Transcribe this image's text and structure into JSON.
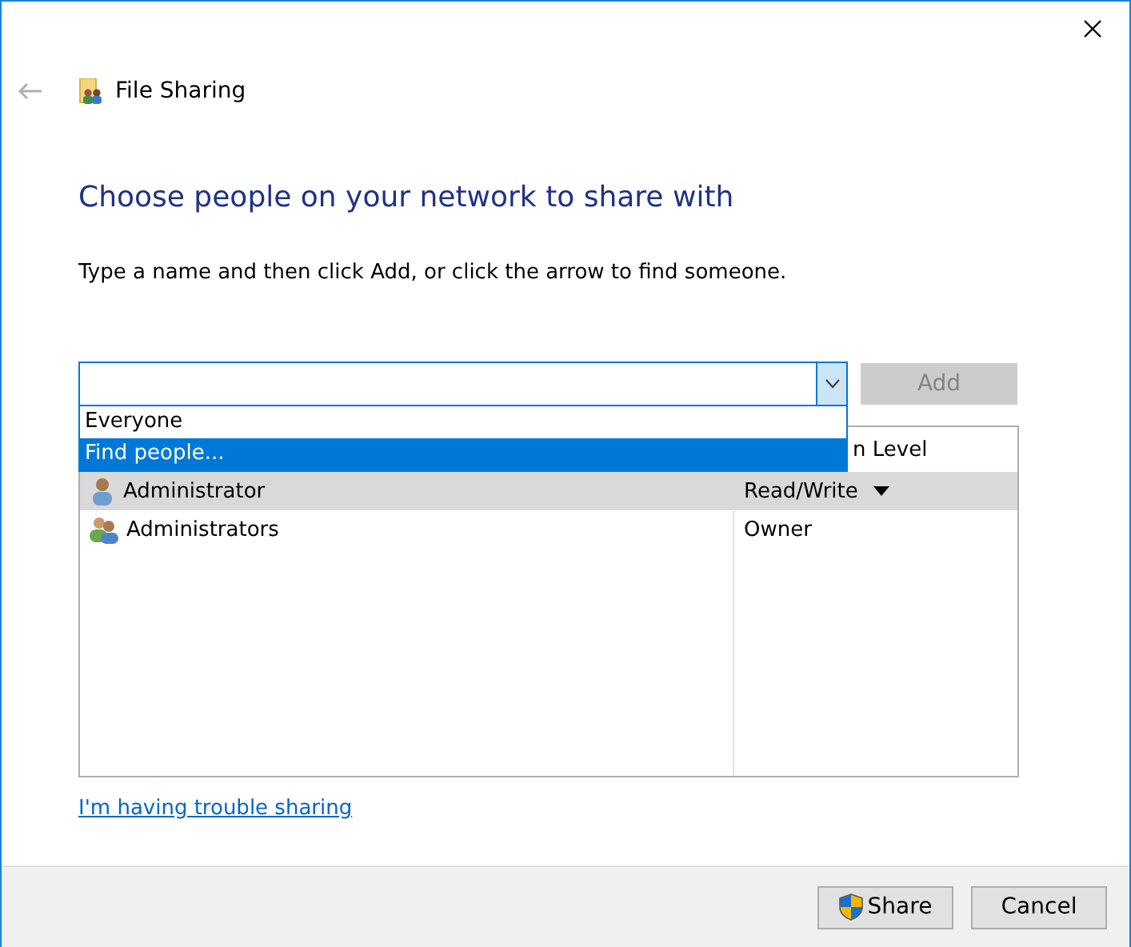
{
  "window": {
    "title": "File Sharing"
  },
  "heading": "Choose people on your network to share with",
  "instruction": "Type a name and then click Add, or click the arrow to find someone.",
  "combo": {
    "expanded": true,
    "options": [
      {
        "label": "Everyone",
        "selected": false
      },
      {
        "label": "Find people...",
        "selected": true
      }
    ]
  },
  "add_button": {
    "label": "Add",
    "disabled": true
  },
  "table": {
    "columns": [
      "",
      "n Level"
    ],
    "rows": [
      {
        "name": "Administrator",
        "kind": "user",
        "level": "Read/Write",
        "has_menu": true,
        "selected": true
      },
      {
        "name": "Administrators",
        "kind": "group",
        "level": "Owner",
        "has_menu": false,
        "selected": false
      }
    ]
  },
  "link": "I'm having trouble sharing",
  "buttons": [
    {
      "label": "Share",
      "kind": "shield"
    },
    {
      "label": "Cancel",
      "kind": "plain"
    }
  ]
}
